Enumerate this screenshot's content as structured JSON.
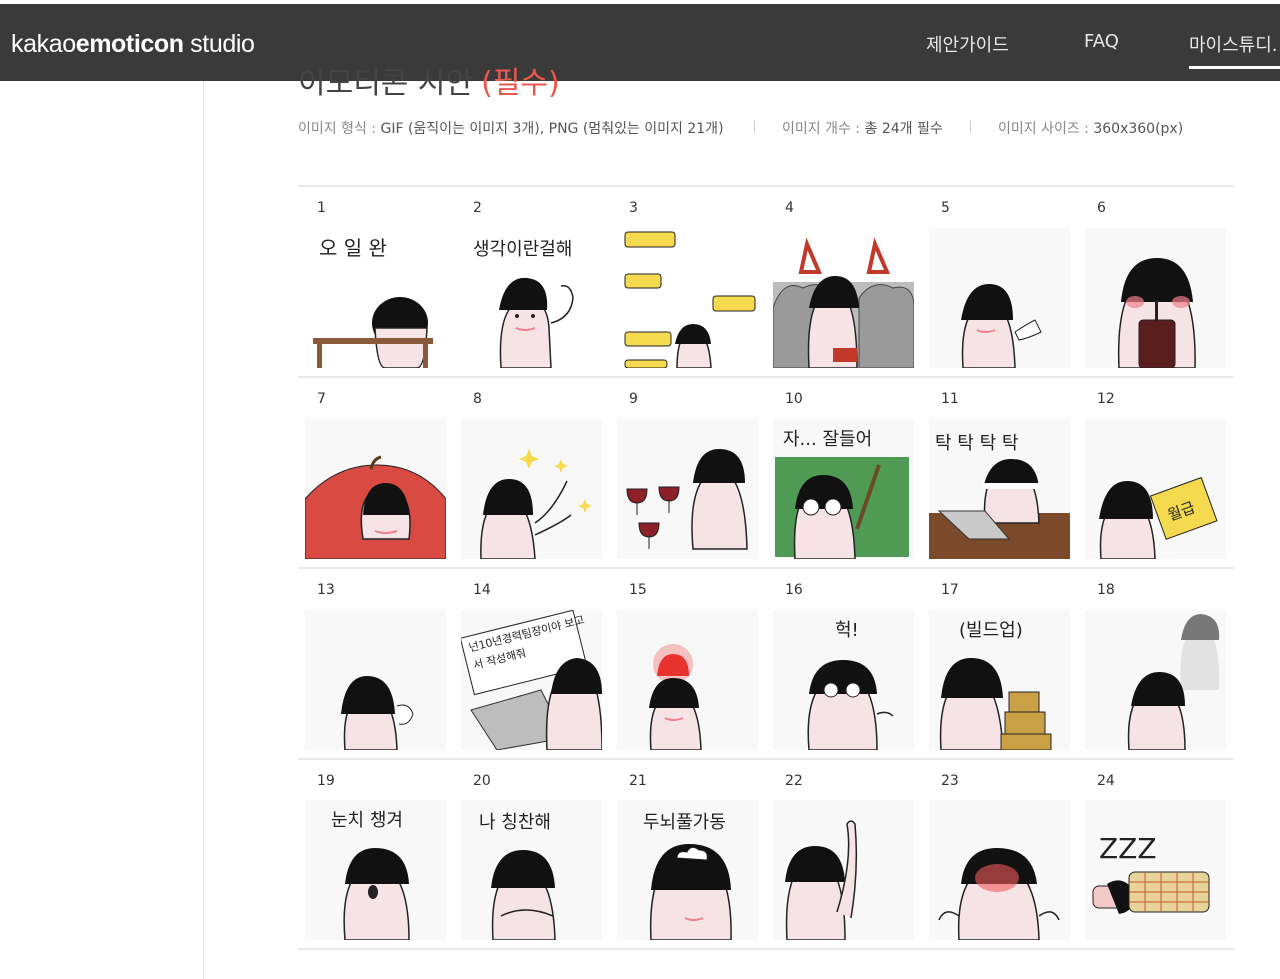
{
  "header": {
    "brand_light": "kakao",
    "brand_bold": "emoticon",
    "brand_suffix": " studio",
    "nav": [
      "제안가이드",
      "FAQ",
      "마이스튜디."
    ]
  },
  "section": {
    "title": "이모티콘 시안",
    "required": "(필수)"
  },
  "specs": [
    {
      "key": "이미지 형식 :",
      "value": "GIF (움직이는 이미지 3개), PNG (멈춰있는 이미지 21개)"
    },
    {
      "key": "이미지 개수 :",
      "value": "총 24개 필수"
    },
    {
      "key": "이미지 사이즈 :",
      "value": "360x360(px)"
    }
  ],
  "emoticons": [
    {
      "number": "1",
      "caption": "오  일  완"
    },
    {
      "number": "2",
      "caption": "생각이란걸해"
    },
    {
      "number": "3",
      "caption": ""
    },
    {
      "number": "4",
      "caption": ""
    },
    {
      "number": "5",
      "caption": ""
    },
    {
      "number": "6",
      "caption": ""
    },
    {
      "number": "7",
      "caption": ""
    },
    {
      "number": "8",
      "caption": ""
    },
    {
      "number": "9",
      "caption": ""
    },
    {
      "number": "10",
      "caption": "자... 잘들어"
    },
    {
      "number": "11",
      "caption": "탁 탁  탁 탁"
    },
    {
      "number": "12",
      "caption": "월급"
    },
    {
      "number": "13",
      "caption": ""
    },
    {
      "number": "14",
      "caption": "넌10년경력팀장이야 보고서 작성해줘"
    },
    {
      "number": "15",
      "caption": ""
    },
    {
      "number": "16",
      "caption": "헉!"
    },
    {
      "number": "17",
      "caption": "(빌드업)"
    },
    {
      "number": "18",
      "caption": ""
    },
    {
      "number": "19",
      "caption": "눈치 챙겨"
    },
    {
      "number": "20",
      "caption": "나  칭찬해"
    },
    {
      "number": "21",
      "caption": "두뇌풀가동"
    },
    {
      "number": "22",
      "caption": ""
    },
    {
      "number": "23",
      "caption": ""
    },
    {
      "number": "24",
      "caption": "ZZZ"
    }
  ],
  "colors": {
    "header_bg": "#3a3a3a",
    "required_red": "#e8584d",
    "character_pink": "#f6e3e6",
    "blush": "#f27f8a"
  }
}
